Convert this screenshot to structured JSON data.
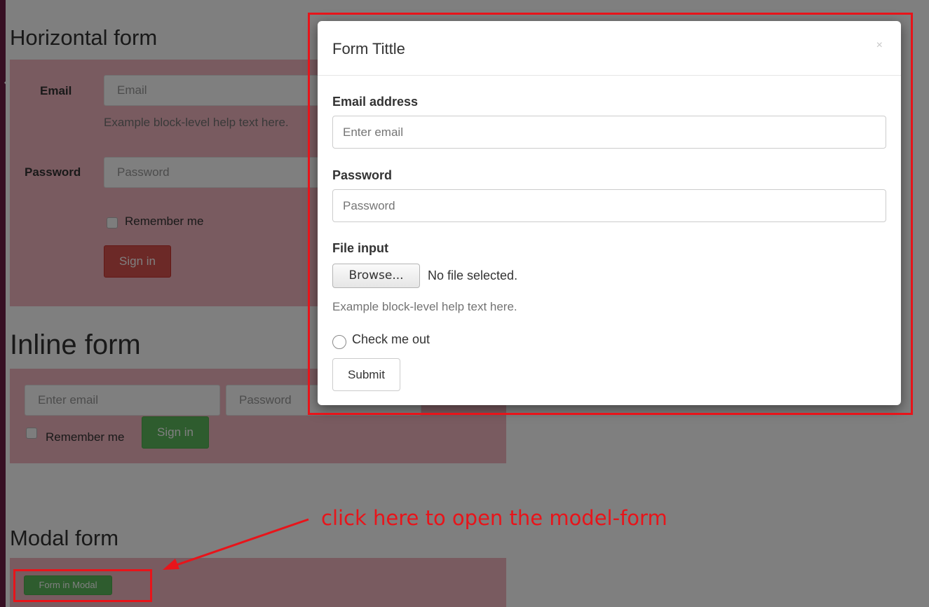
{
  "background": {
    "horizontal_form": {
      "heading": "Horizontal form",
      "email_label": "Email",
      "email_placeholder": "Email",
      "help_text": "Example block-level help text here.",
      "password_label": "Password",
      "password_placeholder": "Password",
      "remember_label": "Remember me",
      "signin_label": "Sign in"
    },
    "inline_form": {
      "heading": "Inline form",
      "email_placeholder": "Enter email",
      "password_placeholder": "Password",
      "remember_label": "Remember me",
      "signin_label": "Sign in"
    },
    "modal_form": {
      "heading": "Modal form",
      "open_button_label": "Form in Modal"
    }
  },
  "modal": {
    "title": "Form Tittle",
    "close_symbol": "×",
    "email_label": "Email address",
    "email_placeholder": "Enter email",
    "password_label": "Password",
    "password_placeholder": "Password",
    "file_label": "File input",
    "browse_label": "Browse...",
    "file_status": "No file selected.",
    "help_text": "Example block-level help text here.",
    "checkbox_label": "Check me out",
    "submit_label": "Submit"
  },
  "annotation": {
    "text": "click here to open the model-form",
    "color": "#e8141a"
  },
  "colors": {
    "panel_pink": "#f2b6c1",
    "danger": "#d9534f",
    "success": "#5cb85c",
    "sidebar_strip": "#6e1f46"
  }
}
